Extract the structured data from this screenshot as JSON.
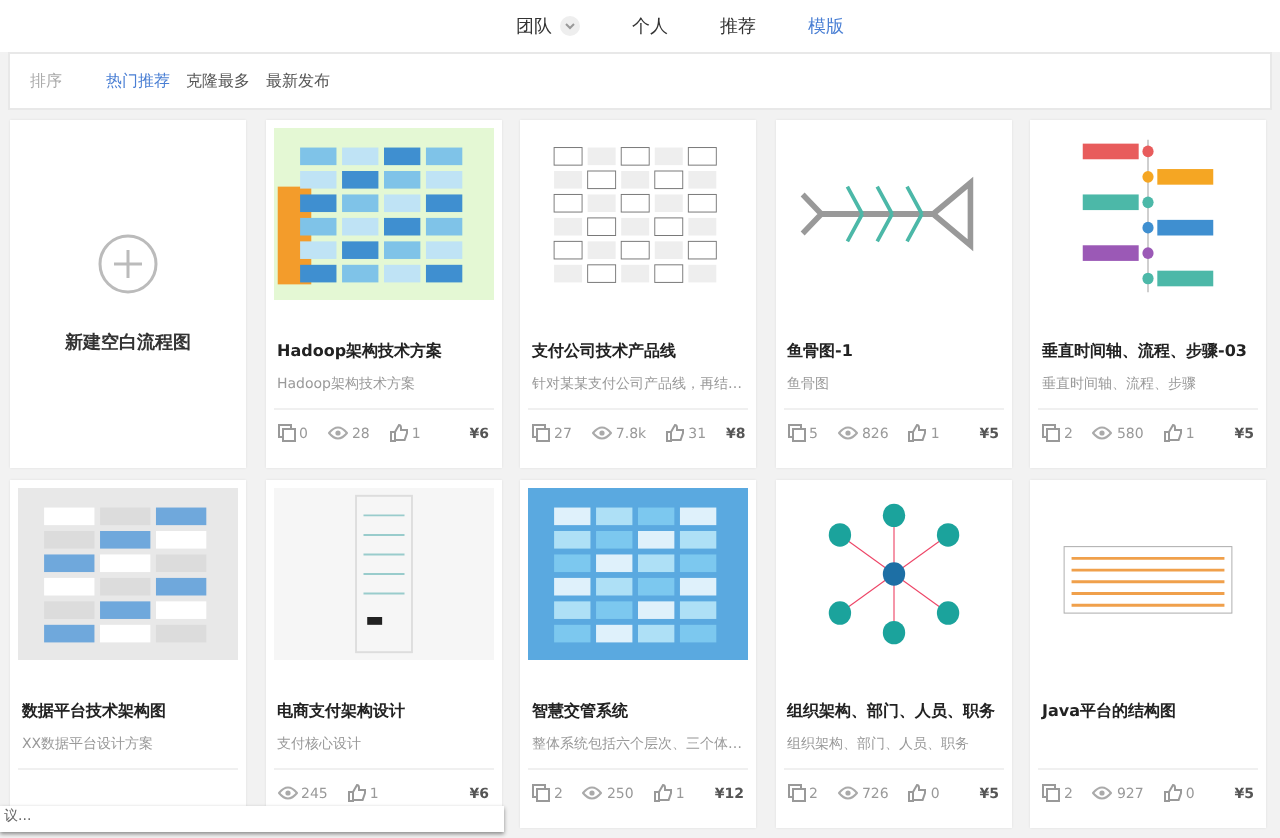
{
  "top_tabs": [
    {
      "label": "团队",
      "dropdown": true,
      "selected": false
    },
    {
      "label": "个人",
      "dropdown": false,
      "selected": false
    },
    {
      "label": "推荐",
      "dropdown": false,
      "selected": false
    },
    {
      "label": "模版",
      "dropdown": false,
      "selected": true
    }
  ],
  "sort": {
    "label": "排序",
    "options": [
      {
        "label": "热门推荐",
        "selected": true
      },
      {
        "label": "克隆最多",
        "selected": false
      },
      {
        "label": "最新发布",
        "selected": false
      }
    ]
  },
  "new_card": {
    "label": "新建空白流程图"
  },
  "cards": [
    {
      "kind": "green-arch",
      "title": "Hadoop架构技术方案",
      "description": "Hadoop架构技术方案",
      "stats": [
        {
          "kind": "copies",
          "value": "0"
        },
        {
          "kind": "views",
          "value": "28"
        },
        {
          "kind": "likes",
          "value": "1"
        },
        {
          "kind": "price",
          "value": "¥6"
        }
      ]
    },
    {
      "kind": "wire",
      "title": "支付公司技术产品线",
      "description": "针对某某支付公司产品线，再结…",
      "stats": [
        {
          "kind": "copies",
          "value": "27"
        },
        {
          "kind": "views",
          "value": "7.8k"
        },
        {
          "kind": "likes",
          "value": "31"
        },
        {
          "kind": "price",
          "value": "¥8"
        }
      ]
    },
    {
      "kind": "fish",
      "title": "鱼骨图-1",
      "description": "鱼骨图",
      "stats": [
        {
          "kind": "copies",
          "value": "5"
        },
        {
          "kind": "views",
          "value": "826"
        },
        {
          "kind": "likes",
          "value": "1"
        },
        {
          "kind": "price",
          "value": "¥5"
        }
      ]
    },
    {
      "kind": "timeline",
      "title": "垂直时间轴、流程、步骤-03",
      "description": "垂直时间轴、流程、步骤",
      "stats": [
        {
          "kind": "copies",
          "value": "2"
        },
        {
          "kind": "views",
          "value": "580"
        },
        {
          "kind": "likes",
          "value": "1"
        },
        {
          "kind": "price",
          "value": "¥5"
        }
      ]
    },
    {
      "kind": "gray-arch",
      "title": "数据平台技术架构图",
      "description": "XX数据平台设计方案"
    },
    {
      "kind": "tall",
      "title": "电商支付架构设计",
      "description": "支付核心设计",
      "stats": [
        {
          "kind": "views",
          "value": "245"
        },
        {
          "kind": "likes",
          "value": "1"
        },
        {
          "kind": "price",
          "value": "¥6"
        }
      ]
    },
    {
      "kind": "blue-arch",
      "title": "智慧交管系统",
      "description": "整体系统包括六个层次、三个体…",
      "stats": [
        {
          "kind": "copies",
          "value": "2"
        },
        {
          "kind": "views",
          "value": "250"
        },
        {
          "kind": "likes",
          "value": "1"
        },
        {
          "kind": "price",
          "value": "¥12"
        }
      ]
    },
    {
      "kind": "org",
      "title": "组织架构、部门、人员、职务",
      "description": "组织架构、部门、人员、职务",
      "stats": [
        {
          "kind": "copies",
          "value": "2"
        },
        {
          "kind": "views",
          "value": "726"
        },
        {
          "kind": "likes",
          "value": "0"
        },
        {
          "kind": "price",
          "value": "¥5"
        }
      ]
    },
    {
      "kind": "java",
      "title": "Java平台的结构图",
      "stats": [
        {
          "kind": "copies",
          "value": "2"
        },
        {
          "kind": "views",
          "value": "927"
        },
        {
          "kind": "likes",
          "value": "0"
        },
        {
          "kind": "price",
          "value": "¥5"
        }
      ]
    }
  ],
  "tooltip": {
    "text": "议..."
  }
}
